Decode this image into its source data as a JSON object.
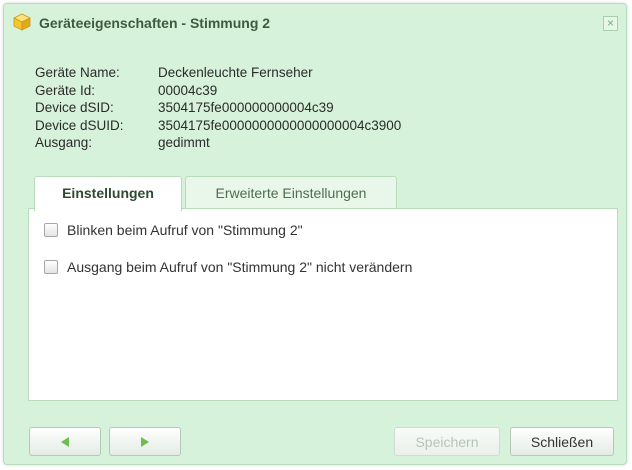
{
  "dialog": {
    "title": "Geräteeigenschaften - Stimmung 2",
    "close_symbol": "×"
  },
  "info": {
    "rows": [
      {
        "label": "Geräte Name:",
        "value": "Deckenleuchte Fernseher"
      },
      {
        "label": "Geräte Id:",
        "value": "00004c39"
      },
      {
        "label": "Device dSID:",
        "value": "3504175fe000000000004c39"
      },
      {
        "label": "Device dSUID:",
        "value": "3504175fe0000000000000000004c3900"
      },
      {
        "label": "Ausgang:",
        "value": "gedimmt"
      }
    ]
  },
  "tabs": [
    {
      "label": "Einstellungen",
      "active": true
    },
    {
      "label": "Erweiterte Einstellungen",
      "active": false
    }
  ],
  "options": [
    {
      "label": "Blinken beim Aufruf von \"Stimmung 2\"",
      "checked": false
    },
    {
      "label": "Ausgang beim Aufruf von \"Stimmung 2\" nicht verändern",
      "checked": false
    }
  ],
  "buttons": {
    "save_label": "Speichern",
    "close_label": "Schließen"
  },
  "icons": {
    "title": "cube-icon",
    "prev": "arrow-left-icon",
    "next": "arrow-right-icon"
  },
  "colors": {
    "dialog_background": "#d7f2da",
    "accent_green": "#6cbf4d",
    "border": "#b9dcbc"
  }
}
